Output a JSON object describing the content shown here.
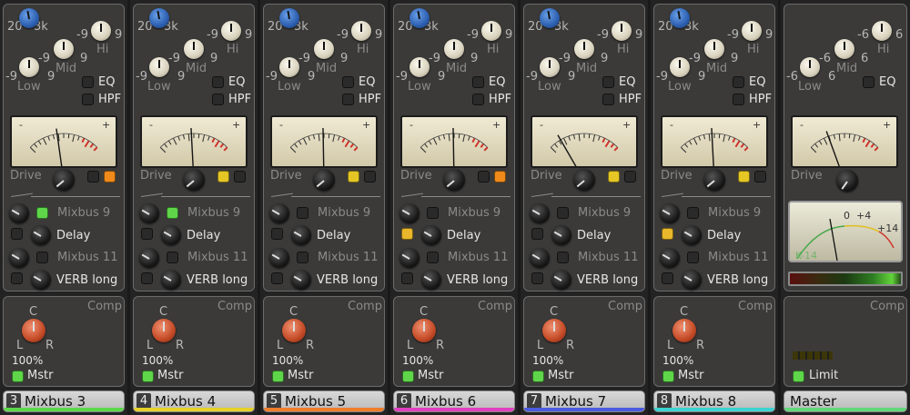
{
  "labels": {
    "freq_low": "20",
    "freq_high": "3k",
    "mid": "Mid",
    "low": "Low",
    "hi": "Hi",
    "eq": "EQ",
    "hpf": "HPF",
    "drive": "Drive",
    "comp": "Comp",
    "pan_c": "C",
    "pan_l": "L",
    "pan_r": "R",
    "pan_pct": "100%",
    "mstr": "Mstr",
    "limit": "Limit",
    "send1": "Mixbus 9",
    "send2": "Delay",
    "send3": "Mixbus 11",
    "send4": "VERB long",
    "meter_minus": "-",
    "meter_plus": "+",
    "m_0": "0",
    "m_p4": "+4",
    "m_p14": "+14",
    "m_k14": "K-14"
  },
  "eq_values": {
    "mid_left": "-9",
    "mid_right": "9",
    "hi_left": "-9",
    "hi_right": "9",
    "low_left": "-9",
    "low_right": "9",
    "master_mid_left": "-6",
    "master_mid_right": "6",
    "master_hi_left": "-6",
    "master_hi_right": "6",
    "master_low_left": "-6",
    "master_low_right": "6"
  },
  "strips": [
    {
      "num": "3",
      "name": "Mixbus 3",
      "color": "#5cd84a"
    },
    {
      "num": "4",
      "name": "Mixbus 4",
      "color": "#e6d22a"
    },
    {
      "num": "5",
      "name": "Mixbus 5",
      "color": "#f07d2a"
    },
    {
      "num": "6",
      "name": "Mixbus 6",
      "color": "#e040c0"
    },
    {
      "num": "7",
      "name": "Mixbus 7",
      "color": "#4b5be0"
    },
    {
      "num": "8",
      "name": "Mixbus 8",
      "color": "#3bd4d0"
    }
  ],
  "master": {
    "name": "Master",
    "color": "#62d87a"
  },
  "colors": {
    "accent_green": "#5fd64a",
    "knob_blue": "#2c5fb0",
    "knob_red": "#c44a26"
  }
}
